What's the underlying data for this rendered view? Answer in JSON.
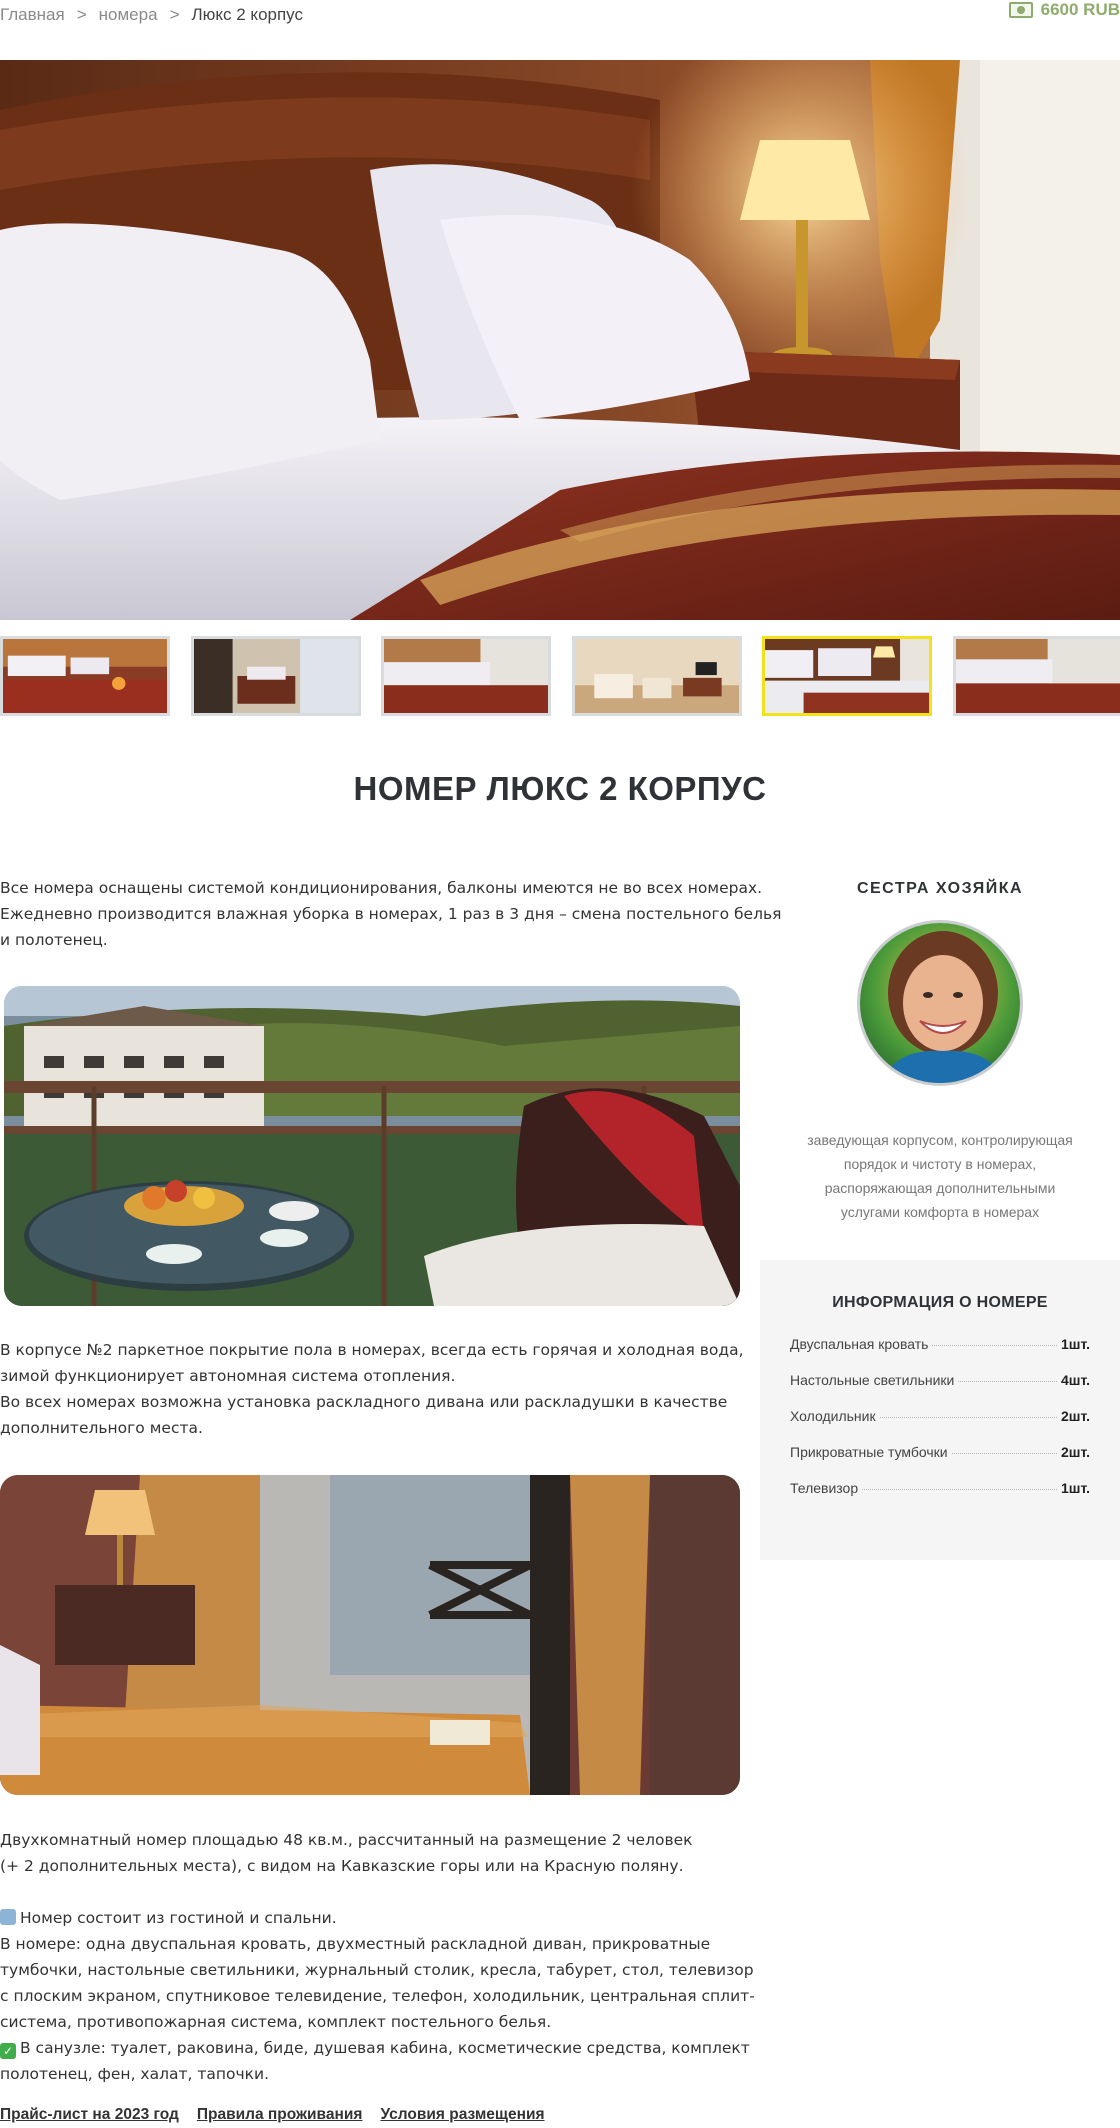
{
  "breadcrumb": {
    "home": "Главная",
    "separator": ">",
    "rooms": "номера",
    "current": "Люкс 2 корпус"
  },
  "price": {
    "icon": "cash-icon",
    "label": "6600 RUB",
    "color": "#8eac6c"
  },
  "gallery": {
    "active_index": 4,
    "thumbnail_count": 6,
    "active_border_color": "#f2e21b"
  },
  "title": "НОМЕР ЛЮКС 2 КОРПУС",
  "intro": {
    "lines": [
      "Все номера оснащены системой кондиционирования, балконы имеются не во всех номерах.",
      "Ежедневно производится влажная уборка в номерах, 1 раз в 3 дня – смена постельного белья",
      "и полотенец."
    ]
  },
  "floor_text": {
    "lines": [
      "В корпусе №2 паркетное покрытие пола в номерах, всегда есть горячая и холодная вода,",
      "зимой функционирует автономная система отопления.",
      "Во всех номерах возможна установка раскладного дивана или раскладушки в качестве",
      "дополнительного места."
    ]
  },
  "description": {
    "lines": [
      "Двухкомнатный номер площадью 48 кв.м., рассчитанный на размещение 2 человек",
      "(+ 2 дополнительных места), с видом на Кавказские горы или на Красную поляну."
    ],
    "composition": "Номер состоит из гостиной и спальни.",
    "equipment_lines": [
      "В номере: одна двуспальная кровать, двухместный раскладной диван, прикроватные",
      "тумбочки, настольные светильники, журнальный столик, кресла, табурет, стол, телевизор",
      "с плоским экраном, спутниковое телевидение, телефон, холодильник, центральная сплит-",
      "система, противопожарная система, комплект постельного белья."
    ],
    "bathroom_lines": [
      "В санузле: туалет, раковина, биде, душевая кабина, косметические средства, комплект",
      "полотенец, фен, халат, тапочки."
    ],
    "check_mark": "✓"
  },
  "links": {
    "price_list": "Прайс-лист на 2023 год",
    "rules": "Правила проживания",
    "conditions": "Условия размещения"
  },
  "host": {
    "title": "СЕСТРА ХОЗЯЙКА",
    "desc_lines": [
      "заведующая корпусом, контролирующая",
      "порядок и чистоту в номерах,",
      "распоряжающая дополнительными",
      "услугами комфорта в номерах"
    ]
  },
  "room_info": {
    "title": "ИНФОРМАЦИЯ О НОМЕРЕ",
    "items": [
      {
        "label": "Двуспальная кровать",
        "qty": "1шт."
      },
      {
        "label": "Настольные светильники",
        "qty": "4шт."
      },
      {
        "label": "Холодильник",
        "qty": "2шт."
      },
      {
        "label": "Прикроватные тумбочки",
        "qty": "2шт."
      },
      {
        "label": "Телевизор",
        "qty": "1шт."
      }
    ]
  }
}
